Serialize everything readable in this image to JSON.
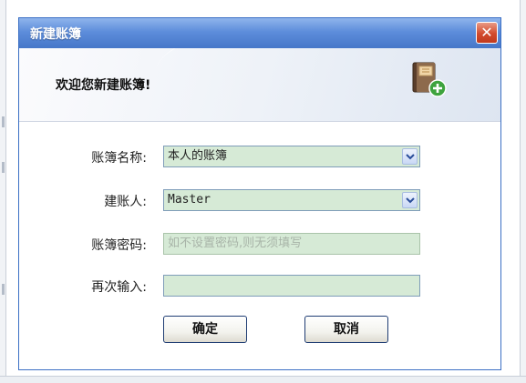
{
  "dialog": {
    "title": "新建账簿",
    "close_glyph": "✕",
    "banner_text": "欢迎您新建账簿!",
    "banner_icon": "book-add-icon"
  },
  "form": {
    "book_name": {
      "label": "账簿名称:",
      "value": "本人的账簿"
    },
    "creator": {
      "label": "建账人:",
      "value": "Master"
    },
    "password": {
      "label": "账簿密码:",
      "placeholder": "如不设置密码,则无须填写"
    },
    "confirm": {
      "label": "再次输入:",
      "value": ""
    }
  },
  "buttons": {
    "ok": "确定",
    "cancel": "取消"
  },
  "colors": {
    "title_bar": "#4677c9",
    "field_bg": "#d6ead6",
    "close": "#d24b2d"
  }
}
